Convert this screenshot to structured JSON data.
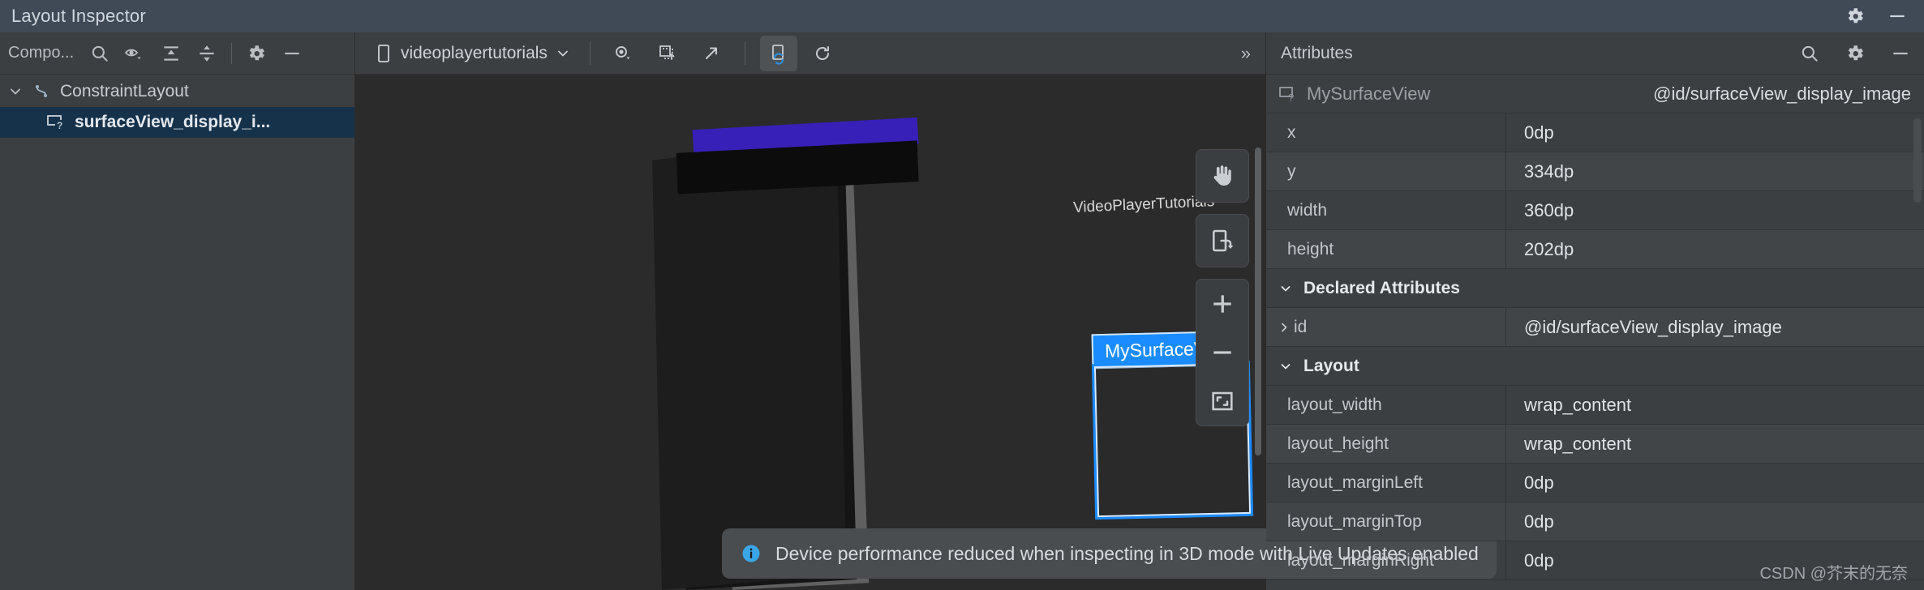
{
  "window": {
    "title": "Layout Inspector",
    "icons": [
      "gear-icon",
      "minimize-icon"
    ]
  },
  "left_panel": {
    "toolbar": {
      "label": "Compo...",
      "buttons": [
        "search-icon",
        "eye-dropdown-icon",
        "expand-all-icon",
        "collapse-all-icon",
        "gear-icon",
        "minimize-icon"
      ]
    },
    "tree": [
      {
        "label": "ConstraintLayout",
        "icon": "constraint-layout-icon",
        "depth": 0,
        "expanded": true,
        "selected": false
      },
      {
        "label": "surfaceView_display_i...",
        "icon": "surface-view-icon",
        "depth": 1,
        "expanded": false,
        "selected": true
      }
    ]
  },
  "center_panel": {
    "toolbar": {
      "device": "videoplayertutorials",
      "device_icon": "phone-icon",
      "dropdown_icon": "chevron-down-icon",
      "buttons": [
        {
          "name": "view-options-icon",
          "active": false
        },
        {
          "name": "layer-overlay-icon",
          "active": false
        },
        {
          "name": "open-external-icon",
          "active": false
        },
        {
          "name": "live-updates-icon",
          "active": true
        },
        {
          "name": "refresh-icon",
          "active": false
        }
      ],
      "overflow": "»"
    },
    "render": {
      "app_label": "VideoPlayerTutorials",
      "selected_component_label": "MySurfaceView",
      "accent_selection": "#1a8cff",
      "status_bar_color": "#3720b8"
    },
    "view_tools": [
      {
        "name": "pan-tool-button",
        "icon": "hand-icon"
      },
      {
        "name": "reset-rotation-button",
        "icon": "reset-view-icon"
      },
      {
        "name": "zoom-in-button",
        "icon": "plus-icon"
      },
      {
        "name": "zoom-out-button",
        "icon": "minus-icon"
      },
      {
        "name": "zoom-to-fit-button",
        "icon": "fit-screen-icon"
      }
    ],
    "banner": {
      "icon": "info-icon",
      "text": "Device performance reduced when inspecting in 3D mode with Live Updates enabled"
    }
  },
  "right_panel": {
    "toolbar": {
      "title": "Attributes",
      "buttons": [
        "search-icon",
        "gear-icon",
        "minimize-icon"
      ]
    },
    "header": {
      "icon": "surface-view-icon",
      "class_name": "MySurfaceView",
      "resource_id": "@id/surfaceView_display_image"
    },
    "rows": [
      {
        "type": "attr",
        "key": "x",
        "value": "0dp"
      },
      {
        "type": "attr",
        "key": "y",
        "value": "334dp"
      },
      {
        "type": "attr",
        "key": "width",
        "value": "360dp"
      },
      {
        "type": "attr",
        "key": "height",
        "value": "202dp"
      },
      {
        "type": "section",
        "key": "Declared Attributes",
        "value": "",
        "expanded": true
      },
      {
        "type": "expandable",
        "key": "id",
        "value": "@id/surfaceView_display_image",
        "expanded": false
      },
      {
        "type": "section",
        "key": "Layout",
        "value": "",
        "expanded": true
      },
      {
        "type": "attr",
        "key": "layout_width",
        "value": "wrap_content"
      },
      {
        "type": "attr",
        "key": "layout_height",
        "value": "wrap_content"
      },
      {
        "type": "attr",
        "key": "layout_marginLeft",
        "value": "0dp"
      },
      {
        "type": "attr",
        "key": "layout_marginTop",
        "value": "0dp"
      },
      {
        "type": "attr",
        "key": "layout_marginRight",
        "value": "0dp"
      }
    ]
  },
  "watermark": "CSDN @芥末的无奈",
  "colors": {
    "titlebar_bg": "#3f4a56",
    "panel_bg": "#3c3f41",
    "viewport_bg": "#2b2b2b",
    "selection_blue": "#16324a",
    "accent": "#1a8cff"
  }
}
